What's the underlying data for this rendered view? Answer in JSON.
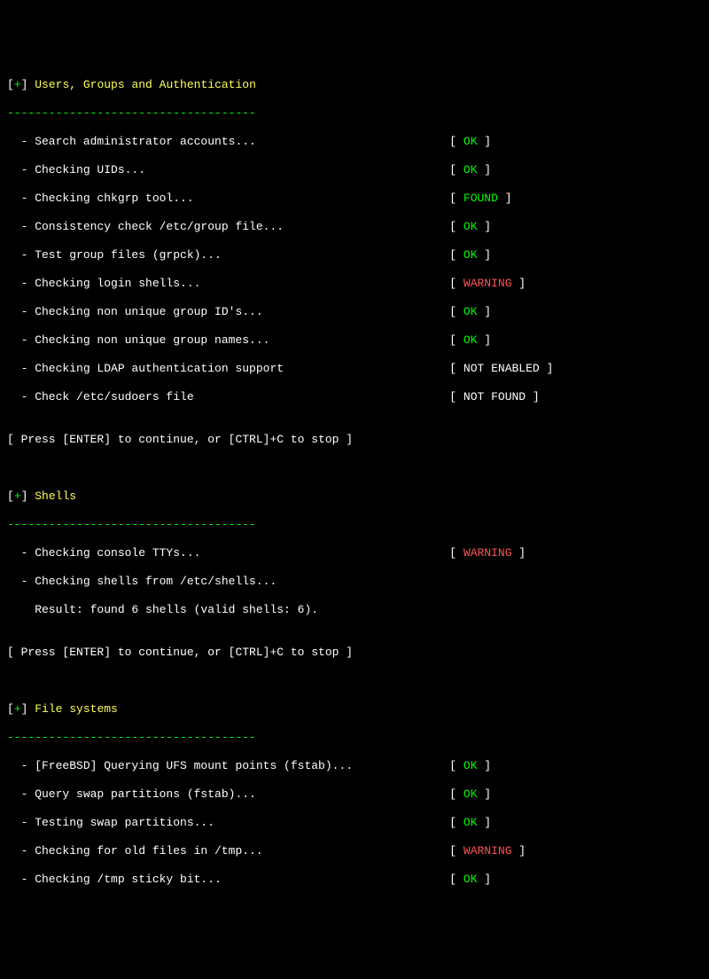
{
  "label_col_width_ch": 64,
  "sections": [
    {
      "title": "Users, Groups and Authentication",
      "divider": "------------------------------------",
      "items": [
        {
          "label": "Search administrator accounts...",
          "status": "OK"
        },
        {
          "label": "Checking UIDs...",
          "status": "OK"
        },
        {
          "label": "Checking chkgrp tool...",
          "status": "FOUND"
        },
        {
          "label": "Consistency check /etc/group file...",
          "status": "OK"
        },
        {
          "label": "Test group files (grpck)...",
          "status": "OK"
        },
        {
          "label": "Checking login shells...",
          "status": "WARNING"
        },
        {
          "label": "Checking non unique group ID's...",
          "status": "OK"
        },
        {
          "label": "Checking non unique group names...",
          "status": "OK"
        },
        {
          "label": "Checking LDAP authentication support",
          "status": "NOT ENABLED"
        },
        {
          "label": "Check /etc/sudoers file",
          "status": "NOT FOUND"
        }
      ],
      "prompt": "[ Press [ENTER] to continue, or [CTRL]+C to stop ]",
      "extra": []
    },
    {
      "title": "Shells",
      "divider": "------------------------------------",
      "items": [
        {
          "label": "Checking console TTYs...",
          "status": "WARNING"
        },
        {
          "label": "Checking shells from /etc/shells...",
          "status": null
        }
      ],
      "extra": [
        "    Result: found 6 shells (valid shells: 6)."
      ],
      "prompt": "[ Press [ENTER] to continue, or [CTRL]+C to stop ]"
    },
    {
      "title": "File systems",
      "divider": "------------------------------------",
      "items": [
        {
          "label": "[FreeBSD] Querying UFS mount points (fstab)...",
          "status": "OK"
        },
        {
          "label": "Query swap partitions (fstab)...",
          "status": "OK"
        },
        {
          "label": "Testing swap partitions...",
          "status": "OK"
        },
        {
          "label": "Checking for old files in /tmp...",
          "status": "WARNING"
        },
        {
          "label": "Checking /tmp sticky bit...",
          "status": "OK"
        }
      ],
      "extra": [],
      "prompt": null
    }
  ],
  "status_classes": {
    "OK": "status-ok",
    "FOUND": "status-found",
    "WARNING": "status-warning",
    "NOT ENABLED": "status-notenabled",
    "NOT FOUND": "status-notfound"
  },
  "section_marker_open": "[",
  "section_marker_plus": "+",
  "section_marker_close": "] ",
  "item_prefix": "  - ",
  "status_open": "[ ",
  "status_close": " ]"
}
